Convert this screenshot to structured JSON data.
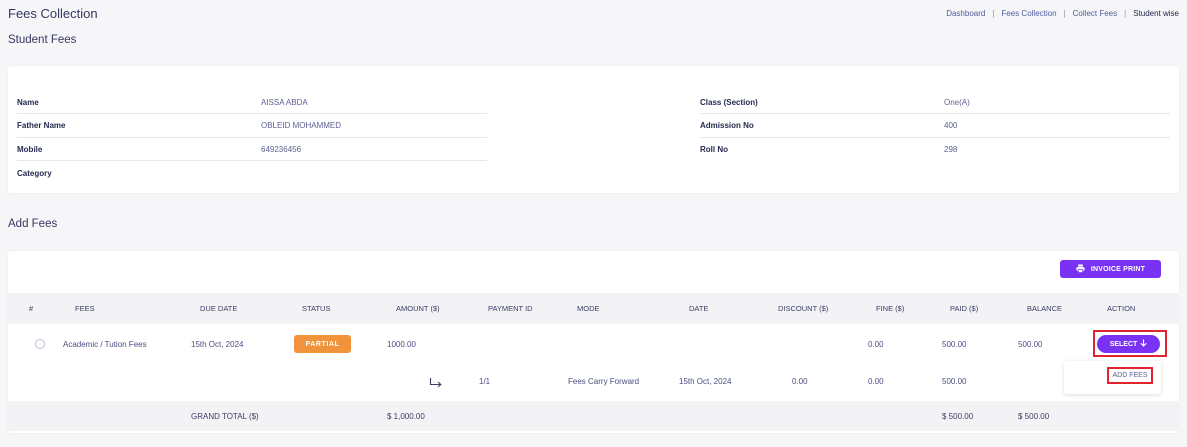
{
  "header": {
    "title": "Fees Collection",
    "breadcrumb": [
      "Dashboard",
      "Fees Collection",
      "Collect Fees",
      "Student wise"
    ],
    "breadcrumb_sep": "|"
  },
  "student_fees": {
    "title": "Student Fees",
    "left": [
      {
        "label": "Name",
        "value": "AISSA ABDA"
      },
      {
        "label": "Father Name",
        "value": "OBLEID MOHAMMED"
      },
      {
        "label": "Mobile",
        "value": "649236456"
      },
      {
        "label": "Category",
        "value": ""
      }
    ],
    "right": [
      {
        "label": "Class (Section)",
        "value": "One(A)"
      },
      {
        "label": "Admission No",
        "value": "400"
      },
      {
        "label": "Roll No",
        "value": "298"
      }
    ]
  },
  "add_fees": {
    "title": "Add Fees",
    "invoice_print_label": "INVOICE PRINT",
    "columns": [
      "#",
      "FEES",
      "DUE DATE",
      "STATUS",
      "AMOUNT ($)",
      "PAYMENT ID",
      "MODE",
      "DATE",
      "DISCOUNT ($)",
      "FINE ($)",
      "PAID ($)",
      "BALANCE",
      "ACTION"
    ],
    "row": {
      "fees": "Academic / Tution Fees",
      "due_date": "15th Oct, 2024",
      "status": "PARTIAL",
      "amount": "1000.00",
      "fine": "0.00",
      "paid": "500.00",
      "balance": "500.00",
      "action_label": "SELECT"
    },
    "sub_row": {
      "payment_id": "1/1",
      "mode": "Fees Carry Forward",
      "date": "15th Oct, 2024",
      "discount": "0.00",
      "fine": "0.00",
      "paid": "500.00"
    },
    "dropdown": {
      "item": "ADD FEES"
    },
    "total": {
      "label": "GRAND TOTAL ($)",
      "amount": "$ 1,000.00",
      "paid": "$ 500.00",
      "balance": "$ 500.00"
    }
  },
  "colors": {
    "accent": "#7a32f2",
    "partial": "#f0933a",
    "highlight": "#e0232e"
  }
}
